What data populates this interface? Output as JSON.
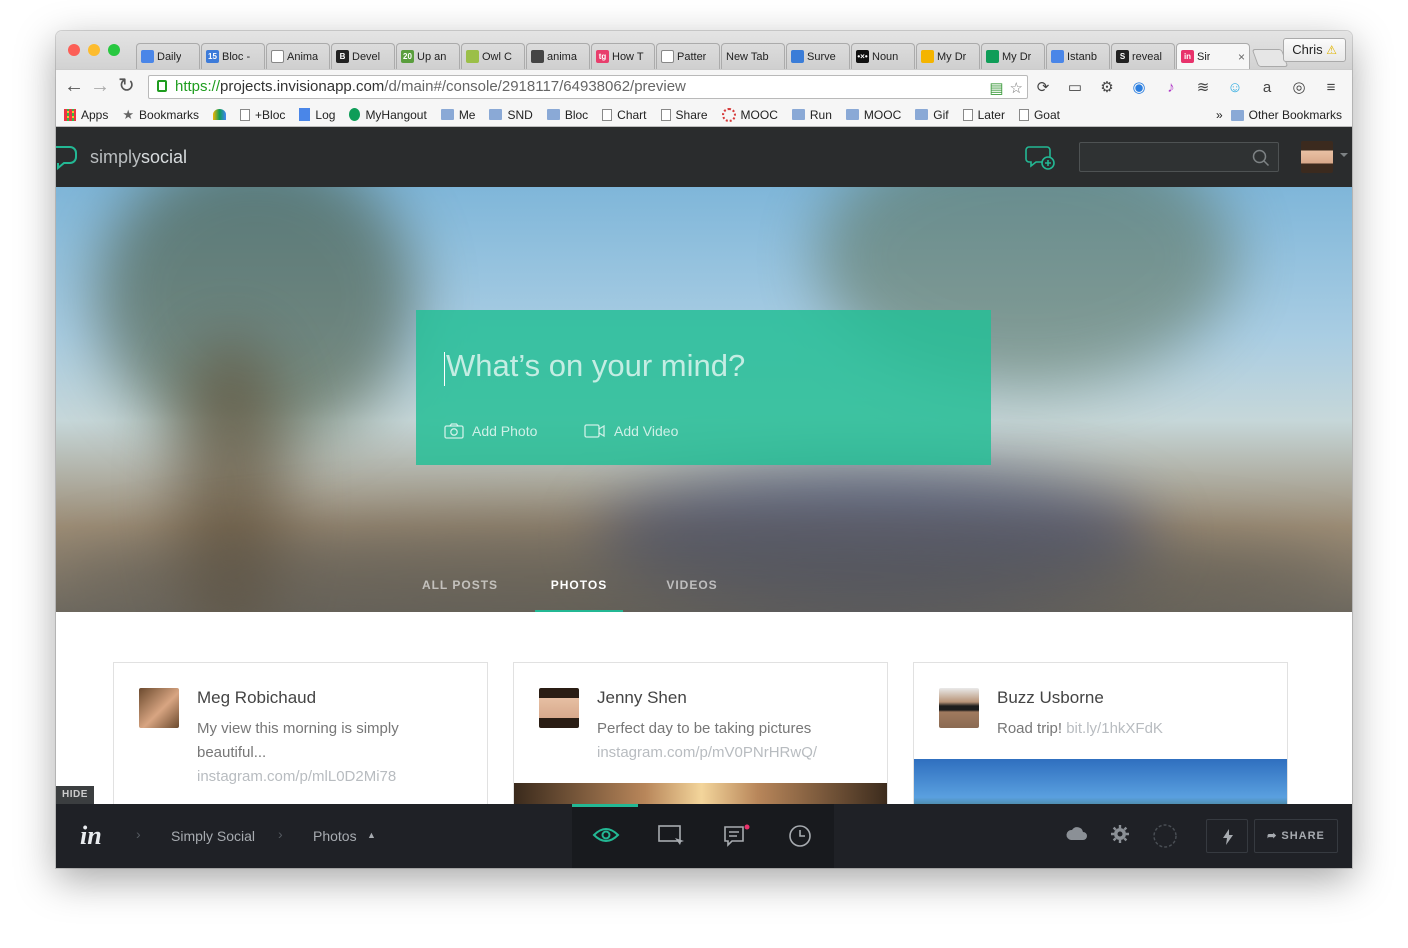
{
  "browser": {
    "tabs": [
      {
        "title": "Daily",
        "favicon_color": "#4a86e8",
        "favicon_text": ""
      },
      {
        "title": "Bloc -",
        "favicon_color": "#3d7bd9",
        "favicon_text": "15"
      },
      {
        "title": "Anima",
        "favicon_color": "#ffffff",
        "favicon_text": ""
      },
      {
        "title": "Devel",
        "favicon_color": "#222222",
        "favicon_text": "B"
      },
      {
        "title": "Up an",
        "favicon_color": "#5a9e3d",
        "favicon_text": "20"
      },
      {
        "title": "Owl C",
        "favicon_color": "#9bbf48",
        "favicon_text": ""
      },
      {
        "title": "anima",
        "favicon_color": "#444444",
        "favicon_text": ""
      },
      {
        "title": "How T",
        "favicon_color": "#e83e6c",
        "favicon_text": "tg"
      },
      {
        "title": "Patter",
        "favicon_color": "#ffffff",
        "favicon_text": ""
      },
      {
        "title": "New Tab",
        "favicon_color": "",
        "favicon_text": ""
      },
      {
        "title": "Surve",
        "favicon_color": "#3b7dd8",
        "favicon_text": ""
      },
      {
        "title": "Noun",
        "favicon_color": "#111111",
        "favicon_text": "•×•"
      },
      {
        "title": "My Dr",
        "favicon_color": "#f4b400",
        "favicon_text": ""
      },
      {
        "title": "My Dr",
        "favicon_color": "#0f9d58",
        "favicon_text": ""
      },
      {
        "title": "Istanb",
        "favicon_color": "#4a86e8",
        "favicon_text": ""
      },
      {
        "title": "reveal",
        "favicon_color": "#222222",
        "favicon_text": "S"
      },
      {
        "title": "Sir",
        "favicon_color": "#e8326b",
        "favicon_text": "in",
        "active": true
      }
    ],
    "profile_name": "Chris",
    "url_scheme": "https://",
    "url_host": "projects.invisionapp.com",
    "url_path": "/d/main#/console/2918117/64938062/preview",
    "bookmarks": [
      {
        "label": "Apps",
        "icon": "apps-grid-icon"
      },
      {
        "label": "Bookmarks",
        "icon": "star-icon"
      },
      {
        "label": "",
        "icon": "drive-icon"
      },
      {
        "label": "+Bloc",
        "icon": "page-icon"
      },
      {
        "label": "Log",
        "icon": "doc-icon"
      },
      {
        "label": "MyHangout",
        "icon": "hangout-icon"
      },
      {
        "label": "Me",
        "icon": "folder-icon"
      },
      {
        "label": "SND",
        "icon": "folder-icon"
      },
      {
        "label": "Bloc",
        "icon": "folder-icon"
      },
      {
        "label": "Chart",
        "icon": "page-icon"
      },
      {
        "label": "Share",
        "icon": "page-icon"
      },
      {
        "label": "MOOC",
        "icon": "mooc-icon"
      },
      {
        "label": "Run",
        "icon": "folder-icon"
      },
      {
        "label": "MOOC",
        "icon": "folder-icon"
      },
      {
        "label": "Gif",
        "icon": "folder-icon"
      },
      {
        "label": "Later",
        "icon": "page-icon"
      },
      {
        "label": "Goat",
        "icon": "page-icon"
      }
    ],
    "more_bookmarks": "»",
    "other_bookmarks": "Other Bookmarks"
  },
  "app": {
    "brand_light": "simply",
    "brand_bold": "social",
    "composer_placeholder": "What’s on your mind?",
    "add_photo": "Add Photo",
    "add_video": "Add Video",
    "tabs": [
      {
        "label": "ALL POSTS"
      },
      {
        "label": "PHOTOS",
        "active": true
      },
      {
        "label": "VIDEOS"
      }
    ],
    "posts": [
      {
        "name": "Meg Robichaud",
        "text": "My view this morning is simply beautiful...",
        "link": "instagram.com/p/mlL0D2Mi78"
      },
      {
        "name": "Jenny Shen",
        "text": "Perfect day to be taking pictures",
        "link": "instagram.com/p/mV0PNrHRwQ/"
      },
      {
        "name": "Buzz Usborne",
        "text": "Road trip!",
        "link": "bit.ly/1hkXFdK"
      }
    ],
    "accent": "#23b894"
  },
  "invision": {
    "hide_label": "HIDE",
    "crumbs": [
      "Simply Social",
      "Photos"
    ],
    "share_label": "SHARE"
  }
}
